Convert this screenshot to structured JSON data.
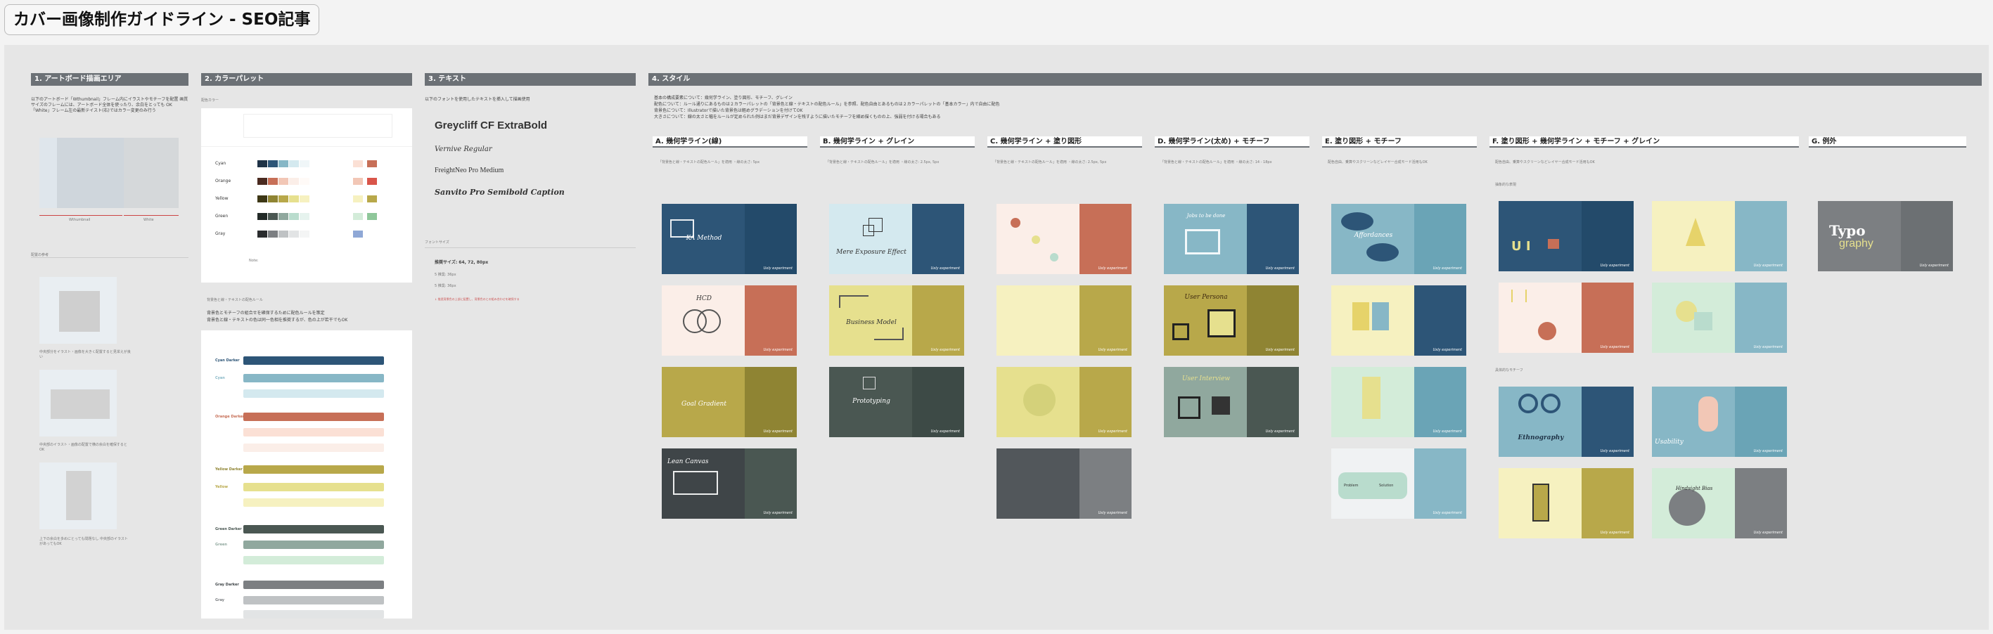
{
  "page_title": "カバー画像制作ガイドライン - SEO記事",
  "sections": {
    "artboard": {
      "title": "1. アートボード描画エリア",
      "desc": "以下のアートボード「Wthumbnail」フレーム内にイラストやモチーフを配置 画質サイズのフレームには、アートボード全体を使ったり、余白をとっても OK 「White」フレーム左の最新テイスト(右)ではカラー変更のみ行う",
      "label_thumbnail": "Wthumbnail",
      "label_white": "White",
      "sub_label": "配置の参考",
      "cap1": "中央部分をイラスト・画像を大きく配置すると見栄えが良い",
      "cap2": "中央部のイラスト・画像の配置で横の余白を確保するとOK",
      "cap3": "上下の余白を多めにとっても問題なし 中央部のイラストがあってもOK"
    },
    "palette": {
      "title": "2. カラーパレット",
      "label": "配色カラー",
      "rows": [
        {
          "name": "Cyan"
        },
        {
          "name": "Orange"
        },
        {
          "name": "Yellow"
        },
        {
          "name": "Green"
        },
        {
          "name": "Gray"
        }
      ],
      "note": "Note:",
      "rule_title": "背景色と線・テキストの配色ルール",
      "rule1": "背景色とモチーフの組合せを確保するために配色ルールを策定",
      "rule2": "背景色と線・テキストの色は同一色相を推奨するが、色の上が若干でもOK",
      "bar_groups": [
        {
          "name": "Cyan Darker"
        },
        {
          "name": "Cyan"
        },
        {
          "name": "Orange Darker"
        },
        {
          "name": "Yellow Darker"
        },
        {
          "name": "Yellow"
        },
        {
          "name": "Green Darker"
        },
        {
          "name": "Green"
        },
        {
          "name": "Gray Darker"
        },
        {
          "name": "Gray"
        }
      ],
      "bar_tag": "Cover Darker"
    },
    "text": {
      "title": "3. テキスト",
      "desc": "以下のフォントを使用したテキストを挿入して描画使用",
      "fonts": [
        "Greycliff CF  ExtraBold",
        "Vernive Regular",
        "FreightNeo Pro  Medium",
        "Sanvito Pro  Semibold Caption"
      ],
      "size_label": "フォントサイズ",
      "size_main": "推奨サイズ: 64, 72, 80px",
      "size_sub1": "5 推奨: 36px",
      "size_sub2": "5 推奨: 36px",
      "size_note": "↓ 推奨背景色の上部に配置し、背景色のとの組み合わせを確保する"
    },
    "style": {
      "title": "4. スタイル",
      "notes": [
        "基本の構成要素について：幾何学ライン、塗り図形、モチーフ、グレイン",
        "配色について：ルール通りにあるものは２カラーパレットの「背景色と線・テキストの配色ルール」を参照、配色自由とあるものは２カラーパレットの「基本カラー」内で自由に配色",
        "背景色について：Illustratorで描いた背景色は軽めグラデーションを付けてOK",
        "大きさについて：線の太さと幅をルールが定められた例はまだ背景デザインを残すように描いたモチーフを細め描くものの上、強弱を付ける場合もある"
      ],
      "categories": [
        {
          "title": "A. 幾何学ライン(線)",
          "desc": "「背景色と線・テキストの配色ルール」を適用 ・線の太さ: 5px"
        },
        {
          "title": "B. 幾何学ライン + グレイン",
          "desc": "「背景色と線・テキストの配色ルール」を適用 ・線の太さ: 2.5px, 5px"
        },
        {
          "title": "C. 幾何学ライン + 塗り図形",
          "desc": "「背景色と線・テキストの配色ルール」を適用 ・線の太さ: 2.5px, 5px"
        },
        {
          "title": "D. 幾何学ライン(太め) + モチーフ",
          "desc": "「背景色と線・テキストの配色ルール」を適用 ・線の太さ: 14 - 18px"
        },
        {
          "title": "E. 塗り図形 + モチーフ",
          "desc": "配色自由、乗算やスクリーンなどレイヤー合成モード活用もOK"
        },
        {
          "title": "F. 塗り図形 + 幾何学ライン + モチーフ + グレイン",
          "desc": "配色自由、乗算やスクリーンなどレイヤー合成モード活用もOK"
        },
        {
          "title": "G. 例外",
          "desc": ""
        }
      ],
      "f_label1": "抽象的な表現",
      "f_label2": "具体的なモチーフ",
      "card_logo": "Uxly  experiment",
      "cards": {
        "ka": "KA Method",
        "mere": "Mere Exposure Effect",
        "hcd": "HCD",
        "business": "Business Model",
        "goal": "Goal Gradient",
        "prototyping": "Prototyping",
        "lean": "Lean Canvas",
        "jobs": "Jobs to be done",
        "persona": "User Persona",
        "interview": "User Interview",
        "affordance": "Affordances",
        "problem": "Problem",
        "solution": "Solution",
        "ethno": "Ethnography",
        "usability": "Usability",
        "bias": "Hindsight Bias",
        "typo1": "Typo",
        "typo2": "graphy"
      }
    }
  },
  "colors": {
    "cyan_dark": "#2d5577",
    "cyan": "#87b7c6",
    "cyan_light": "#d4e9ef",
    "orange": "#c76f57",
    "orange_light": "#fbeee8",
    "yellow_dark": "#8f8433",
    "yellow": "#b8a84a",
    "yellow_light": "#f6f1c0",
    "green_dark": "#4a5752",
    "green": "#b9dccd",
    "gray": "#7c7f82",
    "gray_dark": "#3f4548"
  }
}
